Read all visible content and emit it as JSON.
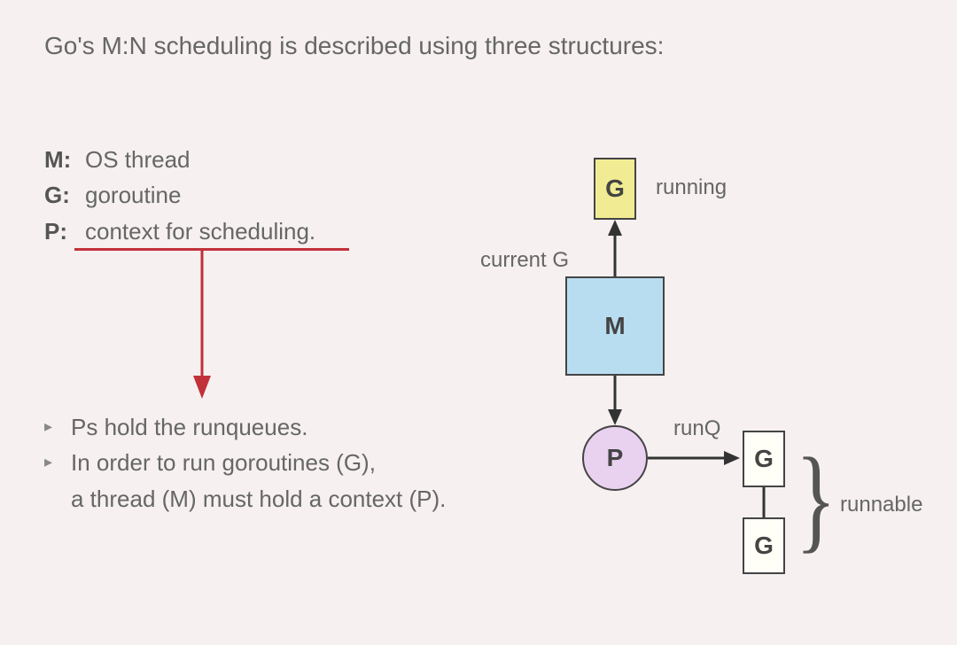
{
  "title": "Go's M:N scheduling is described using three structures:",
  "definitions": [
    {
      "key": "M:",
      "val": "OS thread"
    },
    {
      "key": "G:",
      "val": "goroutine"
    },
    {
      "key": "P:",
      "val": "context for scheduling."
    }
  ],
  "bullets": {
    "item1": "Ps hold the runqueues.",
    "item2_line1": "In order to run goroutines (G),",
    "item2_line2": "a thread (M) must hold a context (P)."
  },
  "diagram": {
    "g_top": "G",
    "m": "M",
    "p": "P",
    "g_q1": "G",
    "g_q2": "G",
    "label_running": "running",
    "label_currentG": "current G",
    "label_runQ": "runQ",
    "label_runnable": "runnable"
  },
  "glyphs": {
    "triangle": "▸",
    "brace": "}"
  },
  "colors": {
    "bg": "#f6f0f0",
    "text": "#555",
    "red": "#c1313a",
    "g_fill": "#f1ec93",
    "m_fill": "#b9ddf0",
    "p_fill": "#e9d1f0"
  }
}
